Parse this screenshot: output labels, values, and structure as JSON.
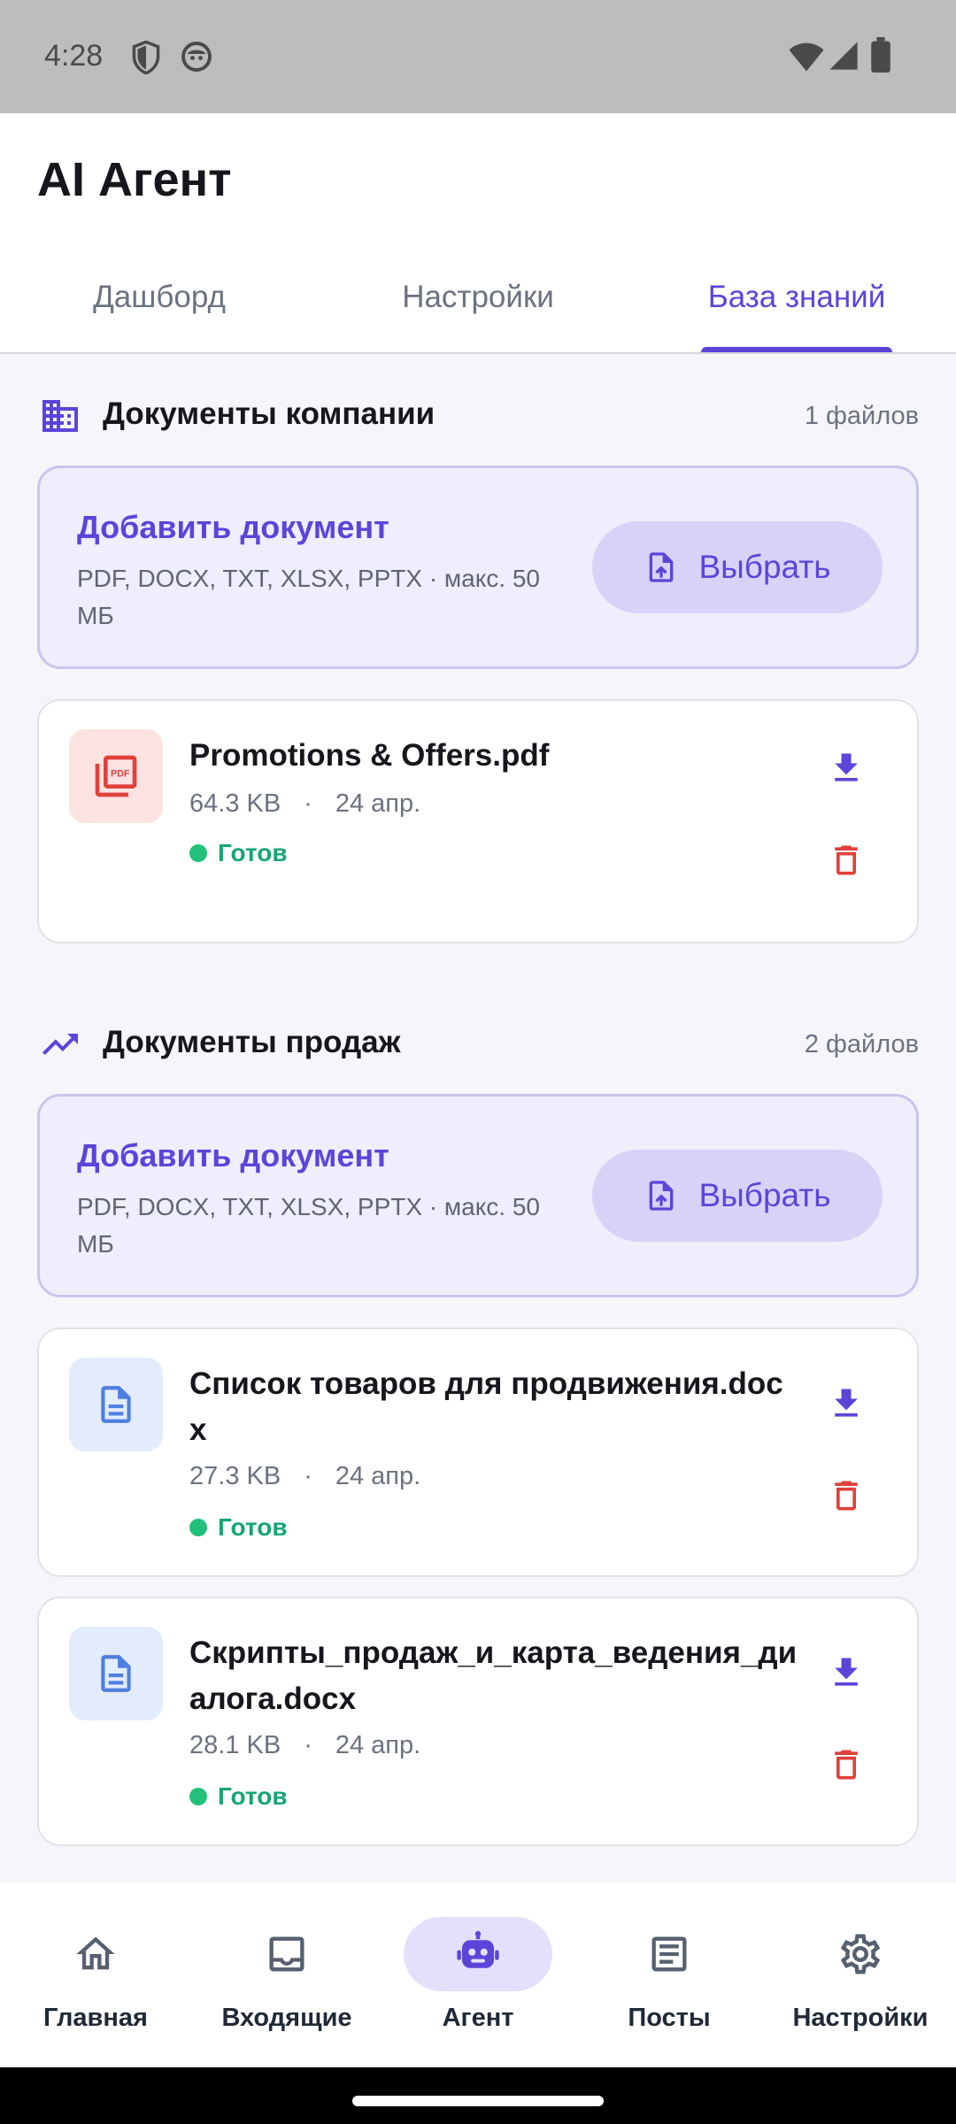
{
  "status_bar": {
    "time": "4:28"
  },
  "app": {
    "title": "AI Агент"
  },
  "tabs": [
    {
      "label": "Дашборд",
      "active": false
    },
    {
      "label": "Настройки",
      "active": false
    },
    {
      "label": "База знаний",
      "active": true
    }
  ],
  "sections": [
    {
      "title": "Документы компании",
      "count": "1 файлов",
      "icon": "building-icon",
      "upload": {
        "title": "Добавить документ",
        "subtitle": "PDF, DOCX, TXT, XLSX, PPTX · макс. 50 МБ",
        "button": "Выбрать"
      },
      "files": [
        {
          "name": "Promotions & Offers.pdf",
          "size": "64.3 KB",
          "separator": "·",
          "date": "24 апр.",
          "status": "Готов",
          "icon": "pdf-file-icon"
        }
      ]
    },
    {
      "title": "Документы продаж",
      "count": "2 файлов",
      "icon": "trending-up-icon",
      "upload": {
        "title": "Добавить документ",
        "subtitle": "PDF, DOCX, TXT, XLSX, PPTX · макс. 50 МБ",
        "button": "Выбрать"
      },
      "files": [
        {
          "name": "Список товаров для продвижения.docx",
          "size": "27.3 KB",
          "separator": "·",
          "date": "24 апр.",
          "status": "Готов",
          "icon": "document-icon"
        },
        {
          "name": "Скрипты_продаж_и_карта_ведения_диалога.docx",
          "size": "28.1 KB",
          "separator": "·",
          "date": "24 апр.",
          "status": "Готов",
          "icon": "document-icon"
        }
      ]
    }
  ],
  "bottom_nav": [
    {
      "label": "Главная",
      "icon": "home-icon",
      "active": false
    },
    {
      "label": "Входящие",
      "icon": "inbox-icon",
      "active": false
    },
    {
      "label": "Агент",
      "icon": "robot-icon",
      "active": true
    },
    {
      "label": "Посты",
      "icon": "article-icon",
      "active": false
    },
    {
      "label": "Настройки",
      "icon": "gear-icon",
      "active": false
    }
  ],
  "colors": {
    "accent": "#5b45d9",
    "status_ready": "#16a672",
    "delete": "#e0413b",
    "upload_bg": "#eeeefc"
  }
}
